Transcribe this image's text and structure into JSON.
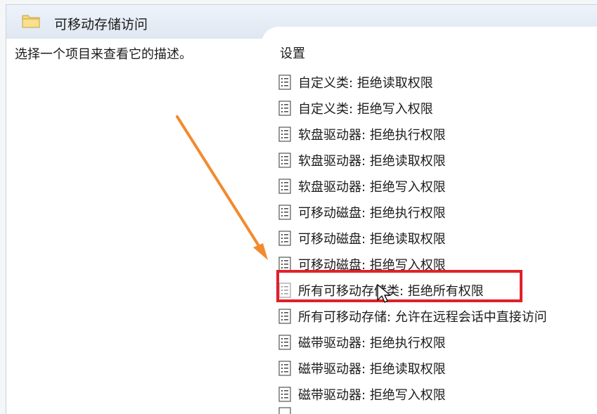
{
  "header": {
    "title": "可移动存储访问",
    "icon": "folder-icon"
  },
  "left_pane": {
    "description": "选择一个项目来查看它的描述。"
  },
  "right_pane": {
    "column_header": "设置",
    "items": [
      {
        "label": "自定义类: 拒绝读取权限"
      },
      {
        "label": "自定义类: 拒绝写入权限"
      },
      {
        "label": "软盘驱动器: 拒绝执行权限"
      },
      {
        "label": "软盘驱动器: 拒绝读取权限"
      },
      {
        "label": "软盘驱动器: 拒绝写入权限"
      },
      {
        "label": "可移动磁盘: 拒绝执行权限"
      },
      {
        "label": "可移动磁盘: 拒绝读取权限"
      },
      {
        "label": "可移动磁盘: 拒绝写入权限"
      },
      {
        "label": "所有可移动存储类: 拒绝所有权限"
      },
      {
        "label": "所有可移动存储: 允许在远程会话中直接访问"
      },
      {
        "label": "磁带驱动器: 拒绝执行权限"
      },
      {
        "label": "磁带驱动器: 拒绝读取权限"
      },
      {
        "label": "磁带驱动器: 拒绝写入权限"
      }
    ],
    "highlighted_index": 8
  },
  "annotation": {
    "arrow_color": "#f28a2e",
    "box_color": "#e0202a"
  }
}
